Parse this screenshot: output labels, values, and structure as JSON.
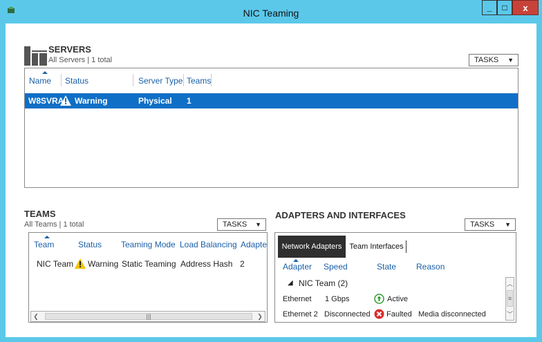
{
  "window": {
    "title": "NIC Teaming",
    "min_label": "_",
    "max_label": "□",
    "close_label": "x"
  },
  "servers": {
    "title": "SERVERS",
    "subtitle": "All Servers | 1 total",
    "tasks_label": "TASKS",
    "columns": [
      "Name",
      "Status",
      "Server Type",
      "Teams"
    ],
    "rows": [
      {
        "name": "W8SVRA",
        "status": "Warning",
        "type": "Physical",
        "teams": "1"
      }
    ]
  },
  "teams": {
    "title": "TEAMS",
    "subtitle": "All Teams | 1 total",
    "tasks_label": "TASKS",
    "columns": [
      "Team",
      "Status",
      "Teaming Mode",
      "Load Balancing",
      "Adapter"
    ],
    "rows": [
      {
        "team": "NIC Team",
        "status": "Warning",
        "mode": "Static Teaming",
        "lb": "Address Hash",
        "adapters": "2"
      }
    ]
  },
  "adapters": {
    "title": "ADAPTERS AND INTERFACES",
    "tasks_label": "TASKS",
    "tabs": [
      "Network Adapters",
      "Team Interfaces"
    ],
    "columns": [
      "Adapter",
      "Speed",
      "State",
      "Reason"
    ],
    "group": "NIC Team (2)",
    "rows": [
      {
        "adapter": "Ethernet",
        "speed": "1 Gbps",
        "state": "Active",
        "reason": ""
      },
      {
        "adapter": "Ethernet 2",
        "speed": "Disconnected",
        "state": "Faulted",
        "reason": "Media disconnected"
      }
    ]
  },
  "colors": {
    "accent": "#5bc8ea",
    "selection": "#0f6fc6",
    "header_text": "#1a5fa8",
    "active_state": "#2e9b2e",
    "faulted_state": "#d92b2b",
    "warning": "#f2c200"
  },
  "icons": [
    "app-icon",
    "server-group-icon",
    "warning-icon",
    "chevron-down-icon",
    "active-up-icon",
    "faulted-x-icon",
    "expand-triangle-icon"
  ]
}
